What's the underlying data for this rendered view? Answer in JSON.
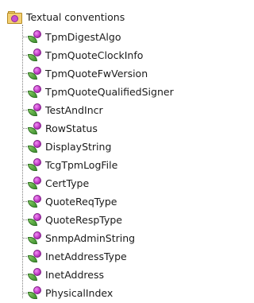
{
  "tree": {
    "root": {
      "label": "Textual conventions",
      "icon": "folder-icon"
    },
    "items": [
      {
        "label": "TpmDigestAlgo",
        "icon": "textual-convention-icon"
      },
      {
        "label": "TpmQuoteClockInfo",
        "icon": "textual-convention-icon"
      },
      {
        "label": "TpmQuoteFwVersion",
        "icon": "textual-convention-icon"
      },
      {
        "label": "TpmQuoteQualifiedSigner",
        "icon": "textual-convention-icon"
      },
      {
        "label": "TestAndIncr",
        "icon": "textual-convention-icon"
      },
      {
        "label": "RowStatus",
        "icon": "textual-convention-icon"
      },
      {
        "label": "DisplayString",
        "icon": "textual-convention-icon"
      },
      {
        "label": "TcgTpmLogFile",
        "icon": "textual-convention-icon"
      },
      {
        "label": "CertType",
        "icon": "textual-convention-icon"
      },
      {
        "label": "QuoteReqType",
        "icon": "textual-convention-icon"
      },
      {
        "label": "QuoteRespType",
        "icon": "textual-convention-icon"
      },
      {
        "label": "SnmpAdminString",
        "icon": "textual-convention-icon"
      },
      {
        "label": "InetAddressType",
        "icon": "textual-convention-icon"
      },
      {
        "label": "InetAddress",
        "icon": "textual-convention-icon"
      },
      {
        "label": "PhysicalIndex",
        "icon": "textual-convention-icon"
      }
    ]
  },
  "colors": {
    "folder": "#f3cf72",
    "leaf": "#3d8f2e",
    "berry": "#c33cc8",
    "connector": "#7f7f7f"
  }
}
